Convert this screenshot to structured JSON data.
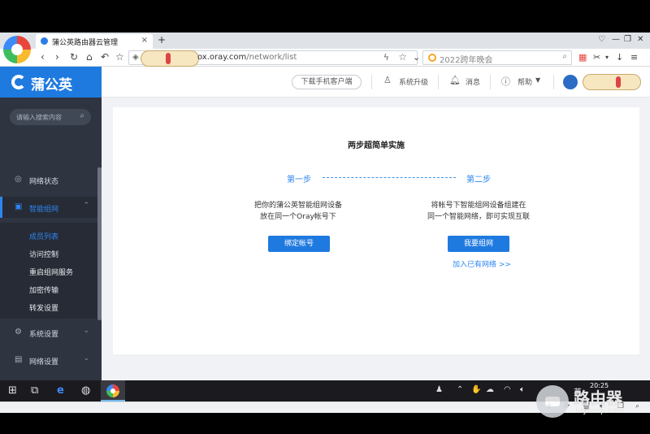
{
  "browser": {
    "tab_title": "蒲公英路由器云管理",
    "tab_close": "×",
    "new_tab": "+",
    "url_visible": "ox.oray.com",
    "url_path": "/network/list",
    "search_placeholder": "2022跨年晚会",
    "nav": {
      "back": "‹",
      "forward": "›",
      "reload": "↻",
      "home": "⌂",
      "undo": "↶",
      "bookmark": "☆"
    },
    "window_controls": {
      "minimize": "—",
      "maximize": "❐",
      "close": "✕"
    }
  },
  "sidebar": {
    "brand": "蒲公英",
    "search_placeholder": "请输入搜索内容",
    "items": [
      {
        "label": "网络状态",
        "icon": "network-status-icon"
      },
      {
        "label": "智能组网",
        "icon": "smart-network-icon",
        "active": true
      },
      {
        "label": "系统设置",
        "icon": "gear-icon"
      },
      {
        "label": "网络设置",
        "icon": "network-settings-icon"
      }
    ],
    "sub_items": [
      "成员列表",
      "访问控制",
      "重启组网服务",
      "加密传输",
      "转发设置"
    ]
  },
  "topbar": {
    "download_client": "下载手机客户端",
    "system_upgrade": "系统升级",
    "messages": "消息",
    "help": "帮助"
  },
  "main": {
    "title": "两步超简单实施",
    "step1": {
      "label": "第一步",
      "line1": "把你的蒲公英智能组网设备",
      "line2": "放在同一个Oray帐号下",
      "button": "绑定帐号"
    },
    "step2": {
      "label": "第二步",
      "line1": "将帐号下智能组网设备组建在",
      "line2": "同一个智能网络，即可实现互联",
      "button": "我要组网",
      "link": "加入已有网络 >>"
    }
  },
  "taskbar": {
    "time": "20:25",
    "ime": "英"
  },
  "watermark": {
    "text": "路由器",
    "sub": "luyouqi.com"
  },
  "colors": {
    "accent": "#1f7ae0",
    "sidebar": "#2e3440",
    "link": "#2d86f0"
  }
}
